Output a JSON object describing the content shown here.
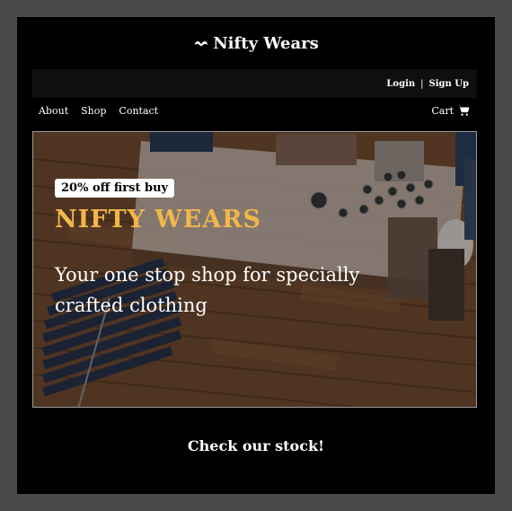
{
  "brand": {
    "name": "Nifty Wears",
    "logo_icon": "mustache-logo-icon"
  },
  "topbar": {
    "login": "Login",
    "separator": "|",
    "signup": "Sign Up"
  },
  "nav": {
    "items": [
      "About",
      "Shop",
      "Contact"
    ],
    "cart_label": "Cart",
    "cart_icon": "shopping-cart-icon"
  },
  "hero": {
    "badge": "20% off first buy",
    "title": "NIFTY WEARS",
    "subtitle": "Your one stop shop for specially crafted clothing",
    "title_color": "#f2b64a"
  },
  "cta": {
    "label": "Check our stock!"
  }
}
